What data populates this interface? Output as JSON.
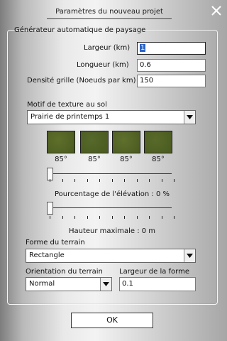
{
  "dialog": {
    "title": "Paramètres du nouveau projet"
  },
  "group": {
    "legend": "Générateur automatique de paysage"
  },
  "fields": {
    "largeur": {
      "label": "Largeur (km)",
      "value": "1"
    },
    "longueur": {
      "label": "Longueur (km)",
      "value": "0.6"
    },
    "densite": {
      "label": "Densité grille (Noeuds par km)",
      "value": "150"
    }
  },
  "texture": {
    "label": "Motif de texture au sol",
    "selected": "Prairie de printemps 1",
    "swatches": [
      {
        "angle": "85°",
        "color": "#5e6f2a"
      },
      {
        "angle": "85°",
        "color": "#56682a"
      },
      {
        "angle": "85°",
        "color": "#5f702c"
      },
      {
        "angle": "85°",
        "color": "#586a29"
      }
    ]
  },
  "elevation": {
    "label": "Pourcentage de l'élévation : 0 %",
    "value_percent": 0
  },
  "height": {
    "label": "Hauteur maximale : 0 m",
    "value_fraction": 0
  },
  "terrain": {
    "shape_label": "Forme du terrain",
    "shape_selected": "Rectangle",
    "orientation_label": "Orientation du terrain",
    "orientation_selected": "Normal",
    "width_label": "Largeur de la forme",
    "width_value": "0.1"
  },
  "buttons": {
    "ok": "OK"
  },
  "colors": {
    "selection": "#2a62c8"
  }
}
